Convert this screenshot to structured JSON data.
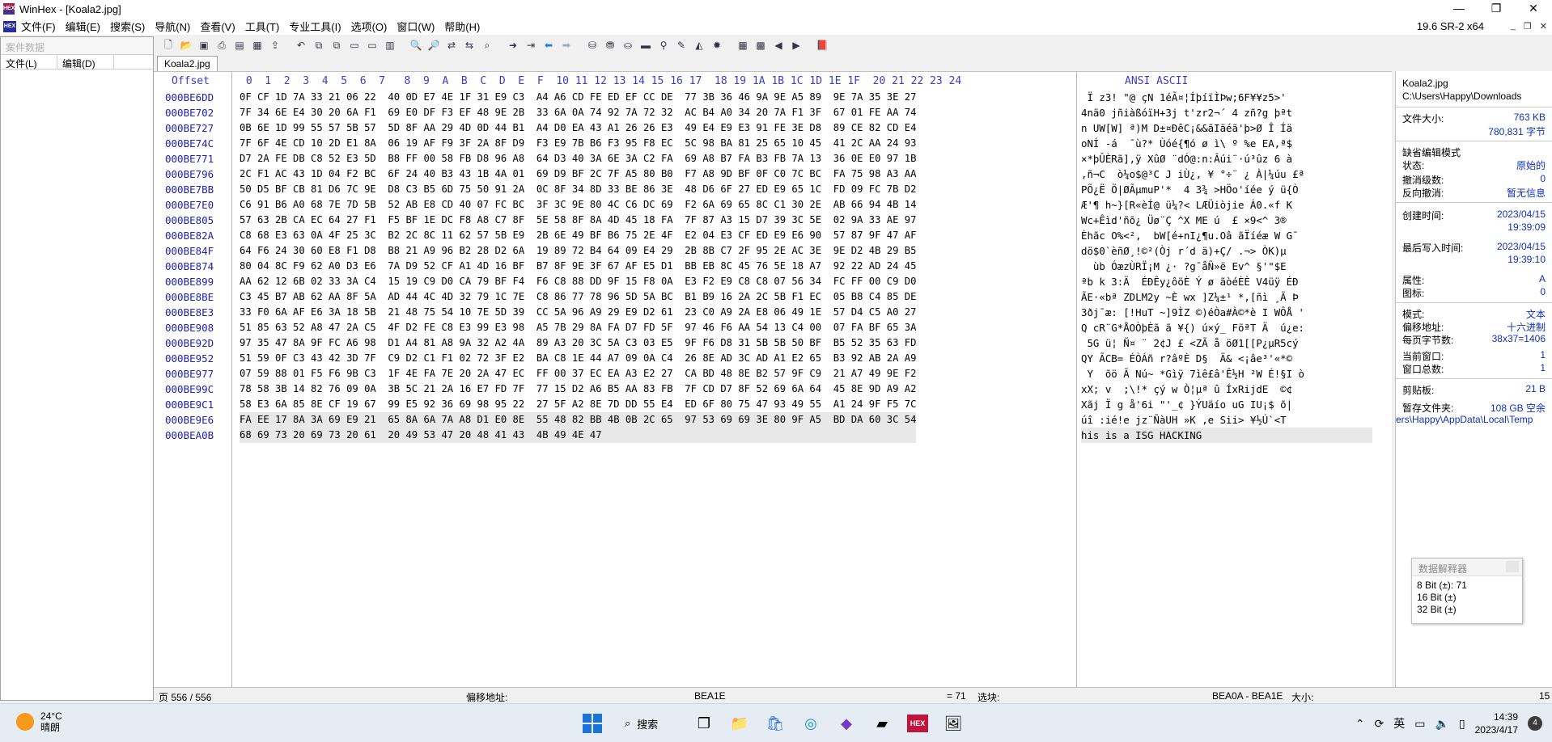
{
  "window": {
    "title": "WinHex - [Koala2.jpg]",
    "app_badge": "HEX",
    "version": "19.6 SR-2 x64"
  },
  "menu": [
    "文件(F)",
    "编辑(E)",
    "搜索(S)",
    "导航(N)",
    "查看(V)",
    "工具(T)",
    "专业工具(I)",
    "选项(O)",
    "窗口(W)",
    "帮助(H)"
  ],
  "left_panel": {
    "search_placeholder": "案件数据",
    "col1": "文件(L)",
    "col2": "编辑(D)"
  },
  "tab": "Koala2.jpg",
  "header": {
    "offset": "Offset",
    "cols": [
      "0",
      "1",
      "2",
      "3",
      "4",
      "5",
      "6",
      "7",
      "8",
      "9",
      "A",
      "B",
      "C",
      "D",
      "E",
      "F",
      "10",
      "11",
      "12",
      "13",
      "14",
      "15",
      "16",
      "17",
      "18",
      "19",
      "1A",
      "1B",
      "1C",
      "1D",
      "1E",
      "1F",
      "20",
      "21",
      "22",
      "23",
      "24"
    ],
    "ansi": "ANSI ASCII"
  },
  "rows": [
    {
      "off": "000BE6DD",
      "hex": "0F CF 1D 7A 33 21 06 22  40 0D E7 4E 1F 31 E9 C3  A4 A6 CD FE ED EF CC DE  77 3B 36 46 9A 9E A5 89  9E 7A 35 3E 27",
      "asc": " Ï z3! \"@ çN 1éÃ¤¦ÍþíïÌÞw;6F¥¥z5>'"
    },
    {
      "off": "000BE702",
      "hex": "7F 34 6E E4 30 20 6A F1  69 E0 DF F3 EF 48 9E 2B  33 6A 0A 74 92 7A 72 32  AC B4 A0 34 20 7A F1 3F  67 01 FE AA 74",
      "asc": "4nä0 jñiàßóïH+3j t'zr2¬´ 4 zñ?g þªt"
    },
    {
      "off": "000BE727",
      "hex": "0B 6E 1D 99 55 57 5B 57  5D 8F AA 29 4D 0D 44 B1  A4 D0 EA 43 A1 26 26 E3  49 E4 E9 E3 91 FE 3E D8  89 CE 82 CD E4",
      "asc": "n UW[W] ª)M D±¤ÐêC¡&&ãIäéã'þ>Ø Î Íä"
    },
    {
      "off": "000BE74C",
      "hex": "7F 6F 4E CD 10 2D E1 8A  06 19 AF F9 3F 2A 8F D9  F3 E9 7B B6 F3 95 F8 EC  5C 98 BA 81 25 65 10 45  41 2C AA 24 93",
      "asc": "oNÍ -á  ¯ù?* Ùóé{¶ó ø ì\\ º %e EA,ª$"
    },
    {
      "off": "000BE771",
      "hex": "D7 2A FE DB C8 52 E3 5D  B8 FF 00 58 FB D8 96 A8  64 D3 40 3A 6E 3A C2 FA  69 A8 B7 FA B3 FB 7A 13  36 0E E0 97 1B",
      "asc": "×*þÛÈRã],ÿ XûØ ¨dÓ@:n:Âúi¨·ú³ûz 6 à"
    },
    {
      "off": "000BE796",
      "hex": "2C F1 AC 43 1D 04 F2 BC  6F 24 40 B3 43 1B 4A 01  69 D9 BF 2C 7F A5 80 B0  F7 A8 9D BF 0F C0 7C BC  FA 75 98 A3 AA",
      "asc": ",ñ¬C  ò¼o$@³C J iÙ¿, ¥ °÷¨ ¿ À|¼úu £ª"
    },
    {
      "off": "000BE7BB",
      "hex": "50 D5 BF CB 81 D6 7C 9E  D8 C3 B5 6D 75 50 91 2A  0C 8F 34 8D 33 BE 86 3E  48 D6 6F 27 ED E9 65 1C  FD 09 FC 7B D2",
      "asc": "PÕ¿Ë Ö|ØÃµmuP'*  4 3¾ >HÖo'íée ý ü{Ò"
    },
    {
      "off": "000BE7E0",
      "hex": "C6 91 B6 A0 68 7E 7D 5B  52 AB E8 CD 40 07 FC BC  3F 3C 9E 80 4C C6 DC 69  F2 6A 69 65 8C C1 30 2E  AB 66 94 4B 14",
      "asc": "Æ'¶ h~}[R«èÍ@ ü¼?< LÆÜiòjie Á0.«f K"
    },
    {
      "off": "000BE805",
      "hex": "57 63 2B CA EC 64 27 F1  F5 BF 1E DC F8 A8 C7 8F  5E 58 8F 8A 4D 45 18 FA  7F 87 A3 15 D7 39 3C 5E  02 9A 33 AE 97",
      "asc": "Wc+Êìd'ñõ¿ Üø¨Ç ^X ME ú  £ ×9<^ 3®"
    },
    {
      "off": "000BE82A",
      "hex": "C8 68 E3 63 0A 4F 25 3C  B2 2C 8C 11 62 57 5B E9  2B 6E 49 BF B6 75 2E 4F  E2 04 E3 CF ED E9 E6 90  57 87 9F 47 AF",
      "asc": "Èhãc O%<²,  bW[é+nI¿¶u.Oâ ãÏíéæ W G¯"
    },
    {
      "off": "000BE84F",
      "hex": "64 F6 24 30 60 E8 F1 D8  B8 21 A9 96 B2 28 D2 6A  19 89 72 B4 64 09 E4 29  2B 8B C7 2F 95 2E AC 3E  9E D2 4B 29 B5",
      "asc": "dö$0`èñØ¸!©²(Òj r´d ä)+Ç/ .¬> ÒK)µ"
    },
    {
      "off": "000BE874",
      "hex": "80 04 8C F9 62 A0 D3 E6  7A D9 52 CF A1 4D 16 BF  B7 8F 9E 3F 67 AF E5 D1  BB EB 8C 45 76 5E 18 A7  92 22 AD 24 45",
      "asc": "  ùb ÓæzÙRÏ¡M ¿· ?g¯åÑ»ë Ev^ §'\"­$E"
    },
    {
      "off": "000BE899",
      "hex": "AA 62 12 6B 02 33 3A C4  15 19 C9 D0 CA 79 BF F4  F6 C8 88 DD 9F 15 F8 0A  E3 F2 E9 C8 C8 07 56 34  FC FF 00 C9 D0",
      "asc": "ªb k 3:Ä  ÉÐÊy¿ôöÈ Ý ø ãòéÈÈ V4üÿ ÉÐ"
    },
    {
      "off": "000BE8BE",
      "hex": "C3 45 B7 AB 62 AA 8F 5A  AD 44 4C 4D 32 79 1C 7E  C8 86 77 78 96 5D 5A BC  B1 B9 16 2A 2C 5B F1 EC  05 B8 C4 85 DE",
      "asc": "ÃE·«bª Z­DLM2y ~È wx ]Z¼±¹ *,[ñì ¸Ä Þ"
    },
    {
      "off": "000BE8E3",
      "hex": "33 F0 6A AF E6 3A 18 5B  21 48 75 54 10 7E 5D 39  CC 5A 96 A9 29 E9 D2 61  23 C0 A9 2A E8 06 49 1E  57 D4 C5 A0 27",
      "asc": "3ðj¯æ: [!HuT ~]9ÌZ ©)éÒa#À©*è I WÔÅ '"
    },
    {
      "off": "000BE908",
      "hex": "51 85 63 52 A8 47 2A C5  4F D2 FE C8 E3 99 E3 98  A5 7B 29 8A FA D7 FD 5F  97 46 F6 AA 54 13 C4 00  07 FA BF 65 3A",
      "asc": "Q cR¨G*ÅOÒþÈã ã ¥{) ú×ý_ FöªT Ä  ú¿e:"
    },
    {
      "off": "000BE92D",
      "hex": "97 35 47 8A 9F FC A6 98  D1 A4 81 A8 9A 32 A2 4A  89 A3 20 3C 5A C3 03 E5  9F F6 D8 31 5B 5B 50 BF  B5 52 35 63 FD",
      "asc": " 5G ü¦ Ñ¤ ¨ 2¢J £ <ZÃ å öØ1[[P¿µR5cý"
    },
    {
      "off": "000BE952",
      "hex": "51 59 0F C3 43 42 3D 7F  C9 D2 C1 F1 02 72 3F E2  BA C8 1E 44 A7 09 0A C4  26 8E AD 3C AD A1 E2 65  B3 92 AB 2A A9",
      "asc": "QY ÃCB= ÉÒÁñ r?âºÈ D§  Ä& ­<­¡âe³'«*©"
    },
    {
      "off": "000BE977",
      "hex": "07 59 88 01 F5 F6 9B C3  1F 4E FA 7E 20 2A 47 EC  FF 00 37 EC EA A3 E2 27  CA BD 48 8E B2 57 9F C9  21 A7 49 9E F2",
      "asc": " Y  õö Ã Nú~ *Gìÿ 7ìê£â'Ê½H ²W É!§I ò"
    },
    {
      "off": "000BE99C",
      "hex": "78 58 3B 14 82 76 09 0A  3B 5C 21 2A 16 E7 FD 7F  77 15 D2 A6 B5 AA 83 FB  7F CD D7 8F 52 69 6A 64  45 8E 9D A9 A2",
      "asc": "xX; v  ;\\!* çý w Ò¦µª û ÍxRijdE  ©¢"
    },
    {
      "off": "000BE9C1",
      "hex": "58 E3 6A 85 8E CF 19 67  99 E5 92 36 69 98 95 22  27 5F A2 8E 7D DD 55 E4  ED 6F 80 75 47 93 49 55  A1 24 9F F5 7C",
      "asc": "Xãj Ï g å'6i \"'_¢ }ÝUäío uG IU¡$ õ|"
    },
    {
      "off": "000BE9E6",
      "hex": "FA EE 17 8A 3A 69 E9 21  65 8A 6A 7A A8 D1 E0 8E  55 48 82 BB 4B 0B 2C 65  97 53 69 69 3E 80 9F A5  BD DA 60 3C 54",
      "asc": "úî :ié!e jz¨ÑàUH »K ,e Sii> ¥½Ú`<T"
    },
    {
      "off": "000BEA0B",
      "hex": "68 69 73 20 69 73 20 61  20 49 53 47 20 48 41 43  4B 49 4E 47",
      "asc": "his is a ISG HACKING"
    }
  ],
  "right_panel": {
    "filename": "Koala2.jpg",
    "path": "C:\\Users\\Happy\\Downloads",
    "size_label": "文件大小:",
    "size_kb": "763 KB",
    "size_bytes": "780,831 字节",
    "mode_label": "缺省编辑模式",
    "state_label": "状态:",
    "state_val": "原始的",
    "undo_level_label": "撤消级数:",
    "undo_level_val": "0",
    "reverse_undo_label": "反向撤消:",
    "reverse_undo_val": "暂无信息",
    "created_label": "创建时间:",
    "created_date": "2023/04/15",
    "created_time": "19:39:09",
    "modified_label": "最后写入时间:",
    "modified_date": "2023/04/15",
    "modified_time": "19:39:10",
    "attr_label": "属性:",
    "attr_val": "A",
    "icon_label": "图标:",
    "icon_val": "0",
    "mode2_label": "模式:",
    "mode2_val": "文本",
    "offset_label": "偏移地址:",
    "offset_val": "十六进制",
    "bpp_label": "每页字节数:",
    "bpp_val": "38x37=1406",
    "curwin_label": "当前窗口:",
    "curwin_val": "1",
    "totwin_label": "窗口总数:",
    "totwin_val": "1",
    "clip_label": "剪贴板:",
    "clip_val": "21 B",
    "temp_label": "暂存文件夹:",
    "temp_val": "108 GB 空余",
    "temp_path": "ers\\Happy\\AppData\\Local\\Temp"
  },
  "data_interpreter": {
    "title": "数据解释器",
    "r8": "8 Bit (±): 71",
    "r16": "16 Bit (±)",
    "r32": "32 Bit (±)"
  },
  "status": {
    "page": "页 556 / 556",
    "offset_label": "偏移地址:",
    "offset_val": "BEA1E",
    "eq": "= 71",
    "sel_label": "选块:",
    "sel_val": "BEA0A - BEA1E",
    "size_label": "大小:",
    "size_val": "15"
  },
  "taskbar": {
    "temp": "24°C",
    "weather": "晴朗",
    "search": "搜索",
    "lang": "英",
    "time": "14:39",
    "date": "2023/4/17",
    "notif": "4"
  }
}
